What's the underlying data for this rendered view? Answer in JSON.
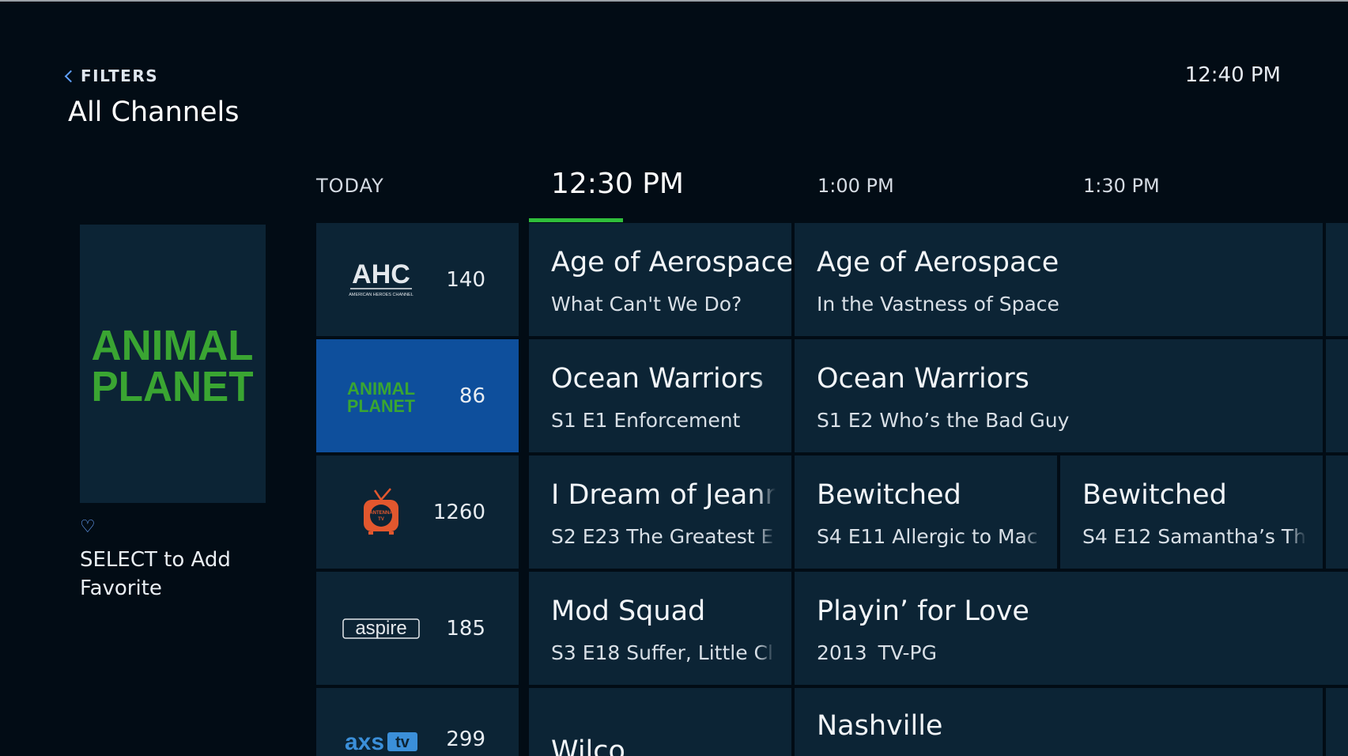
{
  "header": {
    "back_label": "FILTERS",
    "title": "All Channels",
    "clock": "12:40 PM"
  },
  "timeline": {
    "day": "TODAY",
    "slots": [
      "12:30 PM",
      "1:00 PM",
      "1:30 PM"
    ],
    "current_index": 0
  },
  "colors": {
    "background": "#020c15",
    "cell": "#0c2435",
    "selected": "#0e4f9c",
    "accent_green": "#2fbf3b",
    "link_blue": "#5fa0ff"
  },
  "preview": {
    "channel_logo": "ANIMAL PLANET",
    "favorite_icon": "heart-outline-icon",
    "favorite_hint": "SELECT to Add Favorite"
  },
  "channels": [
    {
      "logo": "AHC",
      "logo_sub": "AMERICAN HEROES CHANNEL",
      "number": "140",
      "selected": false,
      "programs": [
        {
          "title": "Age of Aerospace",
          "subtitle": "What Can't We Do?"
        },
        {
          "title": "Age of Aerospace",
          "subtitle": "In the Vastness of Space"
        }
      ]
    },
    {
      "logo": "ANIMAL PLANET",
      "number": "86",
      "selected": true,
      "programs": [
        {
          "title": "Ocean Warriors",
          "subtitle": "S1 E1 Enforcement"
        },
        {
          "title": "Ocean Warriors",
          "subtitle": "S1 E2 Who’s the Bad Guy"
        }
      ]
    },
    {
      "logo": "ANTENNA TV",
      "number": "1260",
      "selected": false,
      "programs": [
        {
          "title": "I Dream of Jeanr",
          "subtitle": "S2 E23 The Greatest E"
        },
        {
          "title": "Bewitched",
          "subtitle": "S4 E11 Allergic to Mac"
        },
        {
          "title": "Bewitched",
          "subtitle": "S4 E12 Samantha’s Th"
        }
      ]
    },
    {
      "logo": "aspire",
      "number": "185",
      "selected": false,
      "programs": [
        {
          "title": "Mod Squad",
          "subtitle": "S3 E18 Suffer, Little Cl"
        },
        {
          "title": "Playin’ for Love",
          "subtitle": "2013   TV-PG"
        }
      ]
    },
    {
      "logo": "axstv",
      "number": "299",
      "selected": false,
      "programs": [
        {
          "title": "Wilco",
          "subtitle": ""
        },
        {
          "title": "Nashville",
          "subtitle": ""
        }
      ]
    }
  ]
}
